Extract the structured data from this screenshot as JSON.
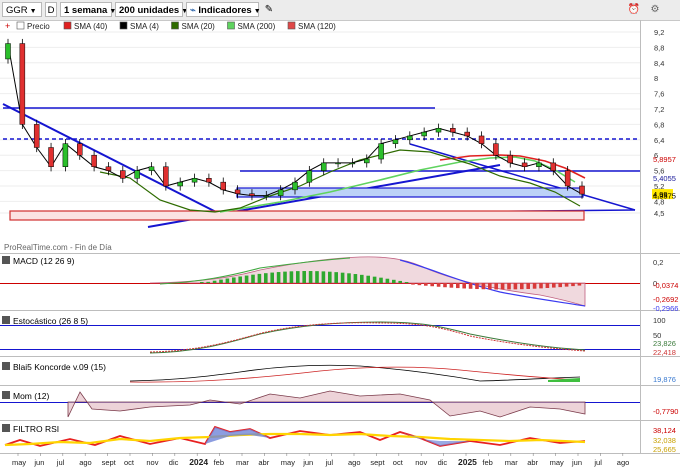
{
  "toolbar": {
    "symbol": "GGR",
    "drawing_mode": "D",
    "period": "1 semana",
    "units": "200 unidades",
    "indicators": "Indicadores"
  },
  "watermark": "ProRealTime.com - Fin de Día",
  "legend": [
    {
      "label": "Precio",
      "color": "#ffffff"
    },
    {
      "label": "SMA (40)",
      "color": "#e02020"
    },
    {
      "label": "SMA (4)",
      "color": "#000000"
    },
    {
      "label": "SMA (20)",
      "color": "#2e6b00"
    },
    {
      "label": "SMA (200)",
      "color": "#5fd35f"
    },
    {
      "label": "SMA (120)",
      "color": "#e04848"
    }
  ],
  "price_axis": {
    "ticks": [
      "9,2",
      "8,8",
      "8,4",
      "8",
      "7,6",
      "7,2",
      "6,8",
      "6,4",
      "6",
      "5,6",
      "5,2",
      "4,8",
      "4,5"
    ],
    "labels": [
      {
        "text": "5,8957",
        "color": "#cc0000",
        "box": false
      },
      {
        "text": "5,4055",
        "color": "#1a1a9a",
        "box": false
      },
      {
        "text": "4,99",
        "color": "#000000",
        "box": true,
        "fill": "#ffe800"
      },
      {
        "text": "4,9575",
        "color": "#000000",
        "box": false
      }
    ]
  },
  "panels": {
    "macd": {
      "title": "MACD (12 26 9)",
      "ticks": [
        "0,2",
        "0",
        "-0,2"
      ],
      "labels": [
        "-0,0374",
        "-0,2692",
        "-0,2966"
      ]
    },
    "stoch": {
      "title": "Estocástico (26 8 5)",
      "ticks": [
        "100",
        "50",
        "0"
      ],
      "labels": [
        "23,826",
        "22,418"
      ]
    },
    "blai": {
      "title": "Blai5 Koncorde v.09 (15)",
      "labels": [
        "19,876"
      ]
    },
    "mom": {
      "title": "Mom (12)",
      "labels": [
        "-0,7790"
      ]
    },
    "rsi": {
      "title": "FILTRO RSI",
      "labels": [
        "38,124",
        "32,038",
        "25,665"
      ]
    }
  },
  "x_axis": [
    "may",
    "jun",
    "jul",
    "ago",
    "sept",
    "oct",
    "nov",
    "dic",
    "2024",
    "feb",
    "mar",
    "abr",
    "may",
    "jun",
    "jul",
    "ago",
    "sept",
    "oct",
    "nov",
    "dic",
    "2025",
    "feb",
    "mar",
    "abr",
    "may",
    "jun",
    "jul",
    "ago"
  ],
  "chart_data": {
    "type": "candlestick",
    "title": "GGR",
    "period": "1 semana",
    "x_range": [
      "2023-05",
      "2025-08"
    ],
    "price_range": [
      4.2,
      9.4
    ],
    "price_closes_approx": [
      8.9,
      6.8,
      6.2,
      5.7,
      6.3,
      6.0,
      5.7,
      5.6,
      5.4,
      5.6,
      5.7,
      5.2,
      5.3,
      5.4,
      5.3,
      5.1,
      5.0,
      4.95,
      4.95,
      5.1,
      5.3,
      5.6,
      5.8,
      5.8,
      5.8,
      5.9,
      6.3,
      6.4,
      6.5,
      6.6,
      6.7,
      6.6,
      6.5,
      6.3,
      6.0,
      5.8,
      5.7,
      5.8,
      5.6,
      5.2,
      4.99
    ],
    "horizontal_levels": [
      7.4,
      6.75,
      6.0
    ],
    "labeled_levels": [
      5.8957,
      5.4055,
      4.99,
      4.9575
    ]
  }
}
